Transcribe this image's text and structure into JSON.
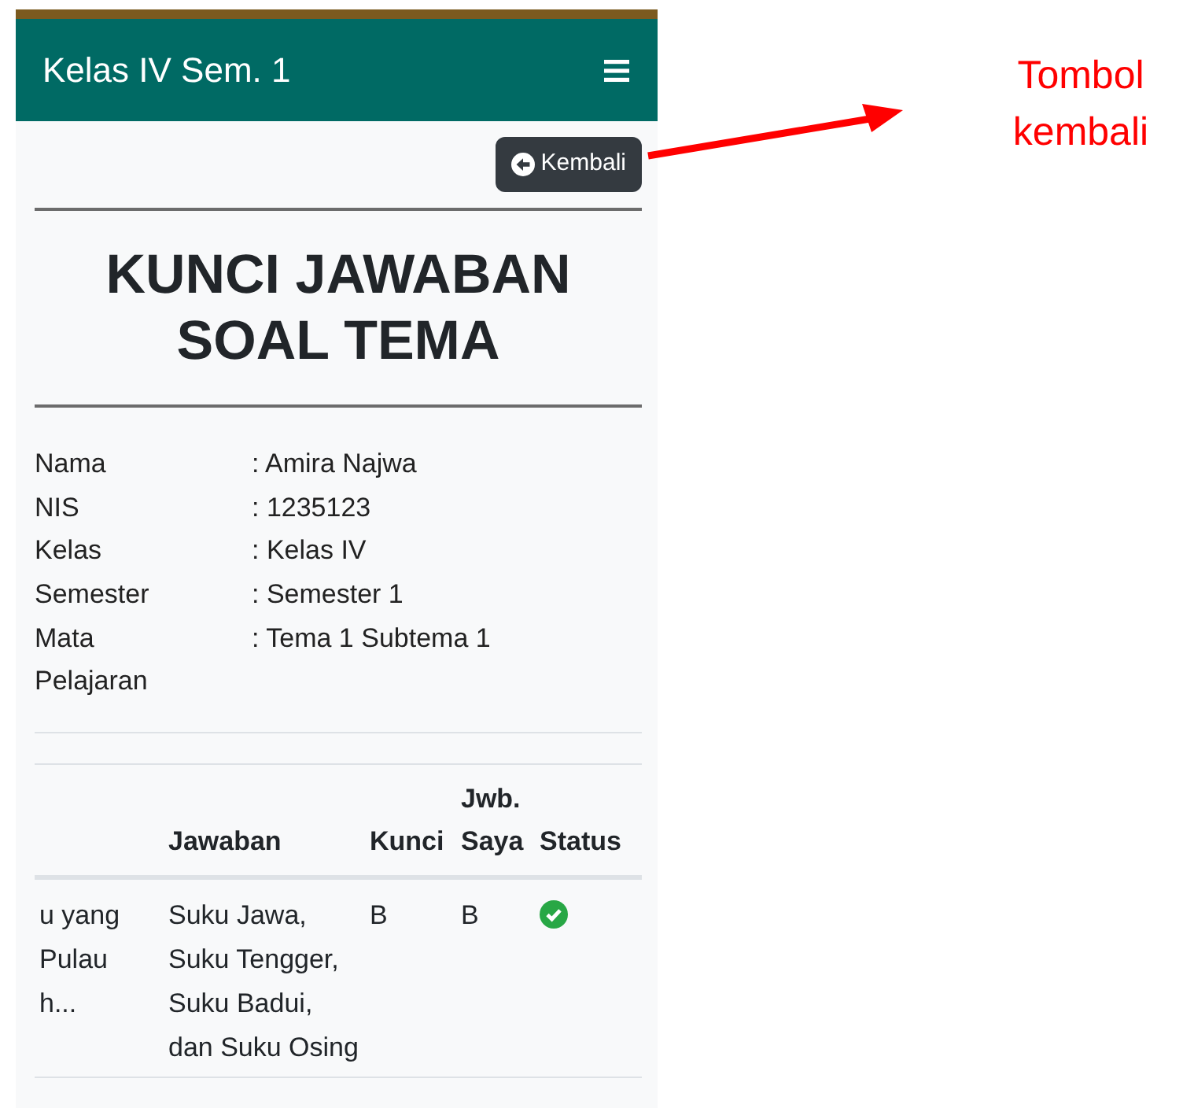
{
  "app_bar": {
    "title": "Kelas IV Sem. 1"
  },
  "back_button": {
    "label": "Kembali"
  },
  "heading": "KUNCI JAWABAN SOAL TEMA",
  "student_info": [
    {
      "label": "Nama",
      "value": ": Amira Najwa"
    },
    {
      "label": "NIS",
      "value": ": 1235123"
    },
    {
      "label": "Kelas",
      "value": ": Kelas IV"
    },
    {
      "label": "Semester",
      "value": ": Semester 1"
    },
    {
      "label": "Mata Pelajaran",
      "value": ": Tema 1 Subtema 1"
    }
  ],
  "table": {
    "columns": [
      "Jawaban",
      "Kunci",
      "Jwb. Saya",
      "Status"
    ],
    "rows": [
      {
        "column_1": "u yang\nPulau\nh...",
        "jawaban": "Suku Jawa, Suku Tengger, Suku Badui, dan Suku Osing",
        "kunci": "B",
        "jwb_saya": "B",
        "correct": true
      }
    ]
  },
  "annotation": {
    "text": "Tombol kembali"
  }
}
